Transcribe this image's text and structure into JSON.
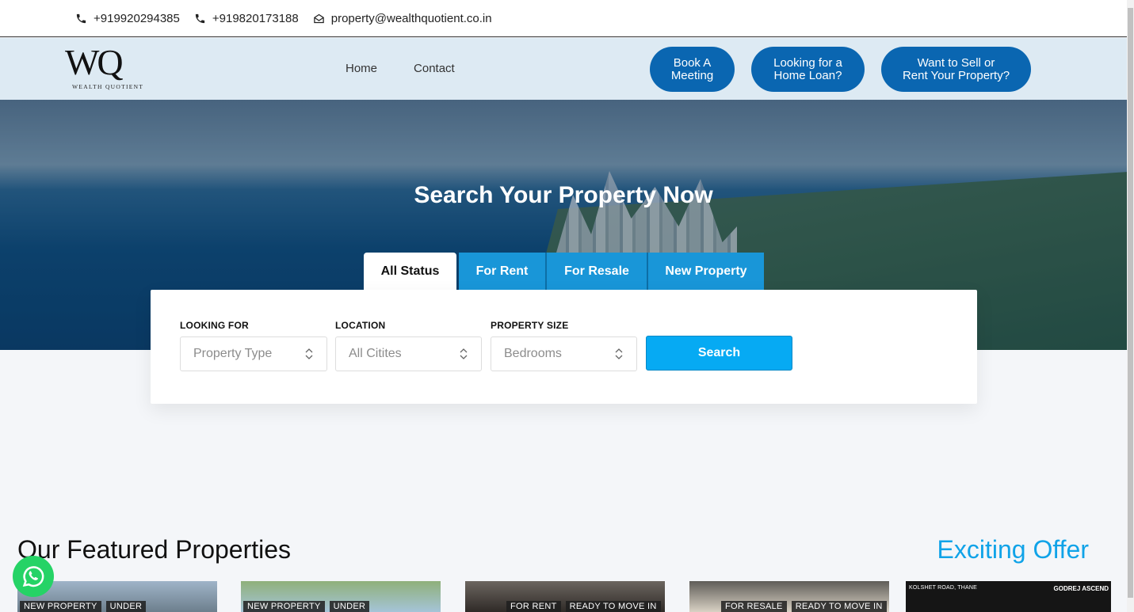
{
  "topbar": {
    "phone1": "+919920294385",
    "phone2": "+919820173188",
    "email": "property@wealthquotient.co.in"
  },
  "nav": {
    "logo_mark": "WQ",
    "logo_tag": "WEALTH QUOTIENT",
    "menu": [
      "Home",
      "Contact"
    ],
    "pill_meeting": "Book A\nMeeting",
    "pill_loan": "Looking for a\nHome Loan?",
    "pill_sell": "Want to Sell or\nRent Your Property?"
  },
  "hero": {
    "title": "Search Your Property Now",
    "tabs": [
      "All Status",
      "For Rent",
      "For Resale",
      "New Property"
    ],
    "active_tab": "All Status"
  },
  "search": {
    "looking_label": "LOOKING FOR",
    "looking_value": "Property Type",
    "location_label": "LOCATION",
    "location_value": "All Citites",
    "size_label": "PROPERTY SIZE",
    "size_value": "Bedrooms",
    "button": "Search"
  },
  "featured": {
    "heading": "Our Featured Properties",
    "offer_heading": "Exciting Offer",
    "cards": [
      {
        "badges": [
          "NEW PROPERTY",
          "UNDER"
        ]
      },
      {
        "badges": [
          "NEW PROPERTY",
          "UNDER"
        ]
      },
      {
        "badges": [
          "FOR RENT",
          "READY TO MOVE IN"
        ]
      },
      {
        "badges": [
          "FOR RESALE",
          "READY TO MOVE IN"
        ]
      }
    ],
    "offer_card": {
      "left_text": "KOLSHET ROAD, THANE",
      "right_text": "GODREJ ASCEND"
    }
  },
  "colors": {
    "accent": "#06aaf3",
    "pill": "#0a66b1",
    "offer": "#10a3e8",
    "whatsapp": "#25d366"
  }
}
